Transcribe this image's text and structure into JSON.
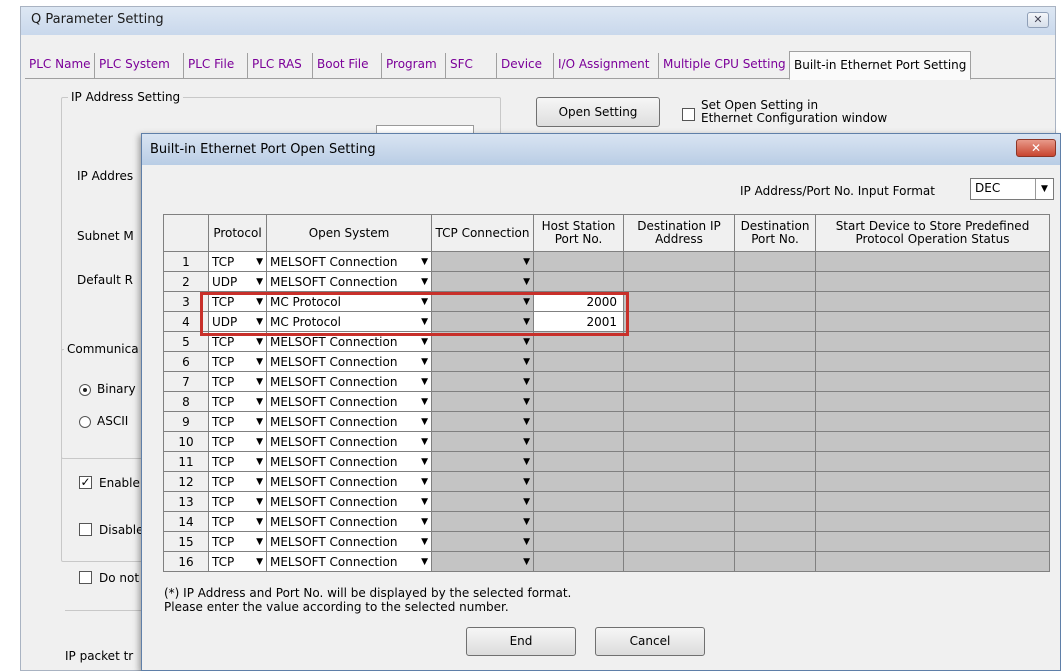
{
  "window": {
    "title": "Q Parameter Setting",
    "close_glyph": "✕"
  },
  "tabs": [
    {
      "label": "PLC Name"
    },
    {
      "label": "PLC System"
    },
    {
      "label": "PLC File"
    },
    {
      "label": "PLC RAS"
    },
    {
      "label": "Boot File"
    },
    {
      "label": "Program"
    },
    {
      "label": "SFC"
    },
    {
      "label": "Device"
    },
    {
      "label": "I/O Assignment"
    },
    {
      "label": "Multiple CPU Setting"
    },
    {
      "label": "Built-in Ethernet Port Setting"
    }
  ],
  "background": {
    "ip_group_label": "IP Address Setting",
    "ip_address_label": "IP Addres",
    "subnet_label": "Subnet M",
    "default_label": "Default R",
    "comm_group_label": "Communica",
    "radio_binary": "Binary",
    "radio_ascii": "ASCII",
    "enable_label": "Enable",
    "disable_label": "Disable",
    "donot_label": "Do not",
    "ip_packet_label": "IP packet tr",
    "open_setting_button": "Open Setting",
    "set_open_label_line1": "Set Open Setting in",
    "set_open_label_line2": "Ethernet Configuration window"
  },
  "dialog": {
    "title": "Built-in Ethernet Port Open Setting",
    "close_glyph": "✕",
    "input_format_label": "IP Address/Port No. Input Format",
    "input_format_value": "DEC",
    "headers": {
      "protocol": "Protocol",
      "open_system": "Open System",
      "tcp_connection": "TCP Connection",
      "host_port": "Host Station Port No.",
      "dest_ip": "Destination IP Address",
      "dest_port": "Destination Port No.",
      "start_device": "Start Device to Store Predefined Protocol Operation Status"
    },
    "rows": [
      {
        "no": "1",
        "protocol": "TCP",
        "open_system": "MELSOFT Connection",
        "host_port": ""
      },
      {
        "no": "2",
        "protocol": "UDP",
        "open_system": "MELSOFT Connection",
        "host_port": ""
      },
      {
        "no": "3",
        "protocol": "TCP",
        "open_system": "MC Protocol",
        "host_port": "2000"
      },
      {
        "no": "4",
        "protocol": "UDP",
        "open_system": "MC Protocol",
        "host_port": "2001"
      },
      {
        "no": "5",
        "protocol": "TCP",
        "open_system": "MELSOFT Connection",
        "host_port": ""
      },
      {
        "no": "6",
        "protocol": "TCP",
        "open_system": "MELSOFT Connection",
        "host_port": ""
      },
      {
        "no": "7",
        "protocol": "TCP",
        "open_system": "MELSOFT Connection",
        "host_port": ""
      },
      {
        "no": "8",
        "protocol": "TCP",
        "open_system": "MELSOFT Connection",
        "host_port": ""
      },
      {
        "no": "9",
        "protocol": "TCP",
        "open_system": "MELSOFT Connection",
        "host_port": ""
      },
      {
        "no": "10",
        "protocol": "TCP",
        "open_system": "MELSOFT Connection",
        "host_port": ""
      },
      {
        "no": "11",
        "protocol": "TCP",
        "open_system": "MELSOFT Connection",
        "host_port": ""
      },
      {
        "no": "12",
        "protocol": "TCP",
        "open_system": "MELSOFT Connection",
        "host_port": ""
      },
      {
        "no": "13",
        "protocol": "TCP",
        "open_system": "MELSOFT Connection",
        "host_port": ""
      },
      {
        "no": "14",
        "protocol": "TCP",
        "open_system": "MELSOFT Connection",
        "host_port": ""
      },
      {
        "no": "15",
        "protocol": "TCP",
        "open_system": "MELSOFT Connection",
        "host_port": ""
      },
      {
        "no": "16",
        "protocol": "TCP",
        "open_system": "MELSOFT Connection",
        "host_port": ""
      }
    ],
    "note_line1": "(*) IP Address and Port No. will be displayed by the selected format.",
    "note_line2": "Please enter the value according to the selected number.",
    "end_button": "End",
    "cancel_button": "Cancel",
    "highlight_color": "#c8302a"
  }
}
